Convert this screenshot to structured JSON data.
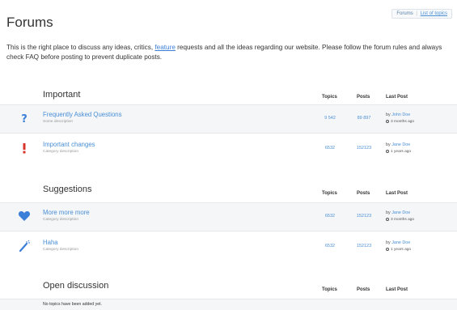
{
  "page": {
    "title": "Forums"
  },
  "top_nav": {
    "forums": "Forums",
    "separator": "|",
    "list_of_topics": "List of topics"
  },
  "intro": {
    "before_link": "This is the right place to discuss any ideas, critics, ",
    "link": "feature",
    "after_link": " requests and all the ideas regarding our website. Please follow the forum rules and always check FAQ before posting to prevent duplicate posts."
  },
  "columns": {
    "topics": "Topics",
    "posts": "Posts",
    "last_post": "Last Post"
  },
  "sections": [
    {
      "title": "Important",
      "rows": [
        {
          "icon": "question-mark-icon",
          "icon_color": "#3b7fd8",
          "name": "Frequently Asked Questions",
          "desc": "Some description",
          "topics": "9 542",
          "posts": "89 897",
          "by": "by",
          "user": "John Doe",
          "time": "3 months ago"
        },
        {
          "icon": "exclamation-icon",
          "icon_color": "#d9342b",
          "name": "Important changes",
          "desc": "Category description",
          "topics": "6532",
          "posts": "152123",
          "by": "by",
          "user": "Jane Doe",
          "time": "1 years ago"
        }
      ]
    },
    {
      "title": "Suggestions",
      "rows": [
        {
          "icon": "heart-icon",
          "icon_color": "#3b7fd8",
          "name": "More more more",
          "desc": "Category description",
          "topics": "6532",
          "posts": "152123",
          "by": "by",
          "user": "Jane Doe",
          "time": "3 months ago"
        },
        {
          "icon": "magic-wand-icon",
          "icon_color": "#3b7fd8",
          "name": "Haha",
          "desc": "Category description",
          "topics": "6532",
          "posts": "152123",
          "by": "by",
          "user": "Jane Doe",
          "time": "1 years ago"
        }
      ]
    },
    {
      "title": "Open discussion",
      "empty_text": "No topics have been added yet."
    }
  ]
}
